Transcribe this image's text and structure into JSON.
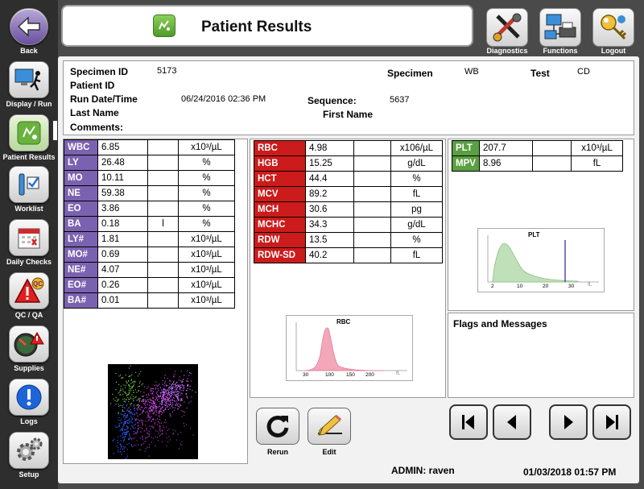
{
  "sidebar": {
    "items": [
      {
        "label": "Back",
        "icon": "back-arrow-icon"
      },
      {
        "label": "Display / Run",
        "icon": "runner-icon"
      },
      {
        "label": "Patient Results",
        "icon": "patient-results-icon"
      },
      {
        "label": "Worklist",
        "icon": "worklist-icon"
      },
      {
        "label": "Daily Checks",
        "icon": "calendar-icon"
      },
      {
        "label": "QC / QA",
        "icon": "qc-warning-icon"
      },
      {
        "label": "Supplies",
        "icon": "gauge-icon"
      },
      {
        "label": "Logs",
        "icon": "info-icon"
      },
      {
        "label": "Setup",
        "icon": "gears-icon"
      }
    ]
  },
  "header": {
    "title": "Patient Results",
    "diagnostics_label": "Diagnostics",
    "functions_label": "Functions",
    "logout_label": "Logout"
  },
  "info": {
    "specimen_id_label": "Specimen ID",
    "specimen_id": "5173",
    "patient_id_label": "Patient ID",
    "run_datetime_label": "Run Date/Time",
    "run_datetime": "06/24/2016 02:36 PM",
    "last_name_label": "Last Name",
    "comments_label": "Comments:",
    "specimen_label": "Specimen",
    "specimen": "WB",
    "test_label": "Test",
    "test": "CD",
    "sequence_label": "Sequence:",
    "sequence": "5637",
    "first_name_label": "First Name"
  },
  "wbc_rows": [
    {
      "param": "WBC",
      "value": "6.85",
      "flag": "",
      "unit": "x10³/µL"
    },
    {
      "param": "LY",
      "value": "26.48",
      "flag": "",
      "unit": "%"
    },
    {
      "param": "MO",
      "value": "10.11",
      "flag": "",
      "unit": "%"
    },
    {
      "param": "NE",
      "value": "59.38",
      "flag": "",
      "unit": "%"
    },
    {
      "param": "EO",
      "value": "3.86",
      "flag": "",
      "unit": "%"
    },
    {
      "param": "BA",
      "value": "0.18",
      "flag": "l",
      "unit": "%"
    },
    {
      "param": "LY#",
      "value": "1.81",
      "flag": "",
      "unit": "x10³/µL"
    },
    {
      "param": "MO#",
      "value": "0.69",
      "flag": "",
      "unit": "x10³/µL"
    },
    {
      "param": "NE#",
      "value": "4.07",
      "flag": "",
      "unit": "x10³/µL"
    },
    {
      "param": "EO#",
      "value": "0.26",
      "flag": "",
      "unit": "x10³/µL"
    },
    {
      "param": "BA#",
      "value": "0.01",
      "flag": "",
      "unit": "x10³/µL"
    }
  ],
  "rbc_rows": [
    {
      "param": "RBC",
      "value": "4.98",
      "flag": "",
      "unit": "x106/µL"
    },
    {
      "param": "HGB",
      "value": "15.25",
      "flag": "",
      "unit": "g/dL"
    },
    {
      "param": "HCT",
      "value": "44.4",
      "flag": "",
      "unit": "%"
    },
    {
      "param": "MCV",
      "value": "89.2",
      "flag": "",
      "unit": "fL"
    },
    {
      "param": "MCH",
      "value": "30.6",
      "flag": "",
      "unit": "pg"
    },
    {
      "param": "MCHC",
      "value": "34.3",
      "flag": "",
      "unit": "g/dL"
    },
    {
      "param": "RDW",
      "value": "13.5",
      "flag": "",
      "unit": "%"
    },
    {
      "param": "RDW-SD",
      "value": "40.2",
      "flag": "",
      "unit": "fL"
    }
  ],
  "plt_rows": [
    {
      "param": "PLT",
      "value": "207.7",
      "flag": "",
      "unit": "x10³/µL"
    },
    {
      "param": "MPV",
      "value": "8.96",
      "flag": "",
      "unit": "fL"
    }
  ],
  "rbc_histogram": {
    "title": "RBC",
    "ticks": [
      "30",
      "100",
      "150",
      "200"
    ],
    "unit": "fL",
    "color": "#f4a7b9"
  },
  "plt_histogram": {
    "title": "PLT",
    "ticks": [
      "2",
      "10",
      "20",
      "30"
    ],
    "unit": "fL",
    "color": "#bfe0b8"
  },
  "flags": {
    "title": "Flags and Messages"
  },
  "actions": {
    "rerun_label": "Rerun",
    "edit_label": "Edit"
  },
  "status": {
    "user": "ADMIN: raven",
    "datetime": "01/03/2018 01:57 PM"
  },
  "colors": {
    "wbc": "#7b62b0",
    "rbc": "#cc1b1b",
    "plt": "#5aa042"
  }
}
